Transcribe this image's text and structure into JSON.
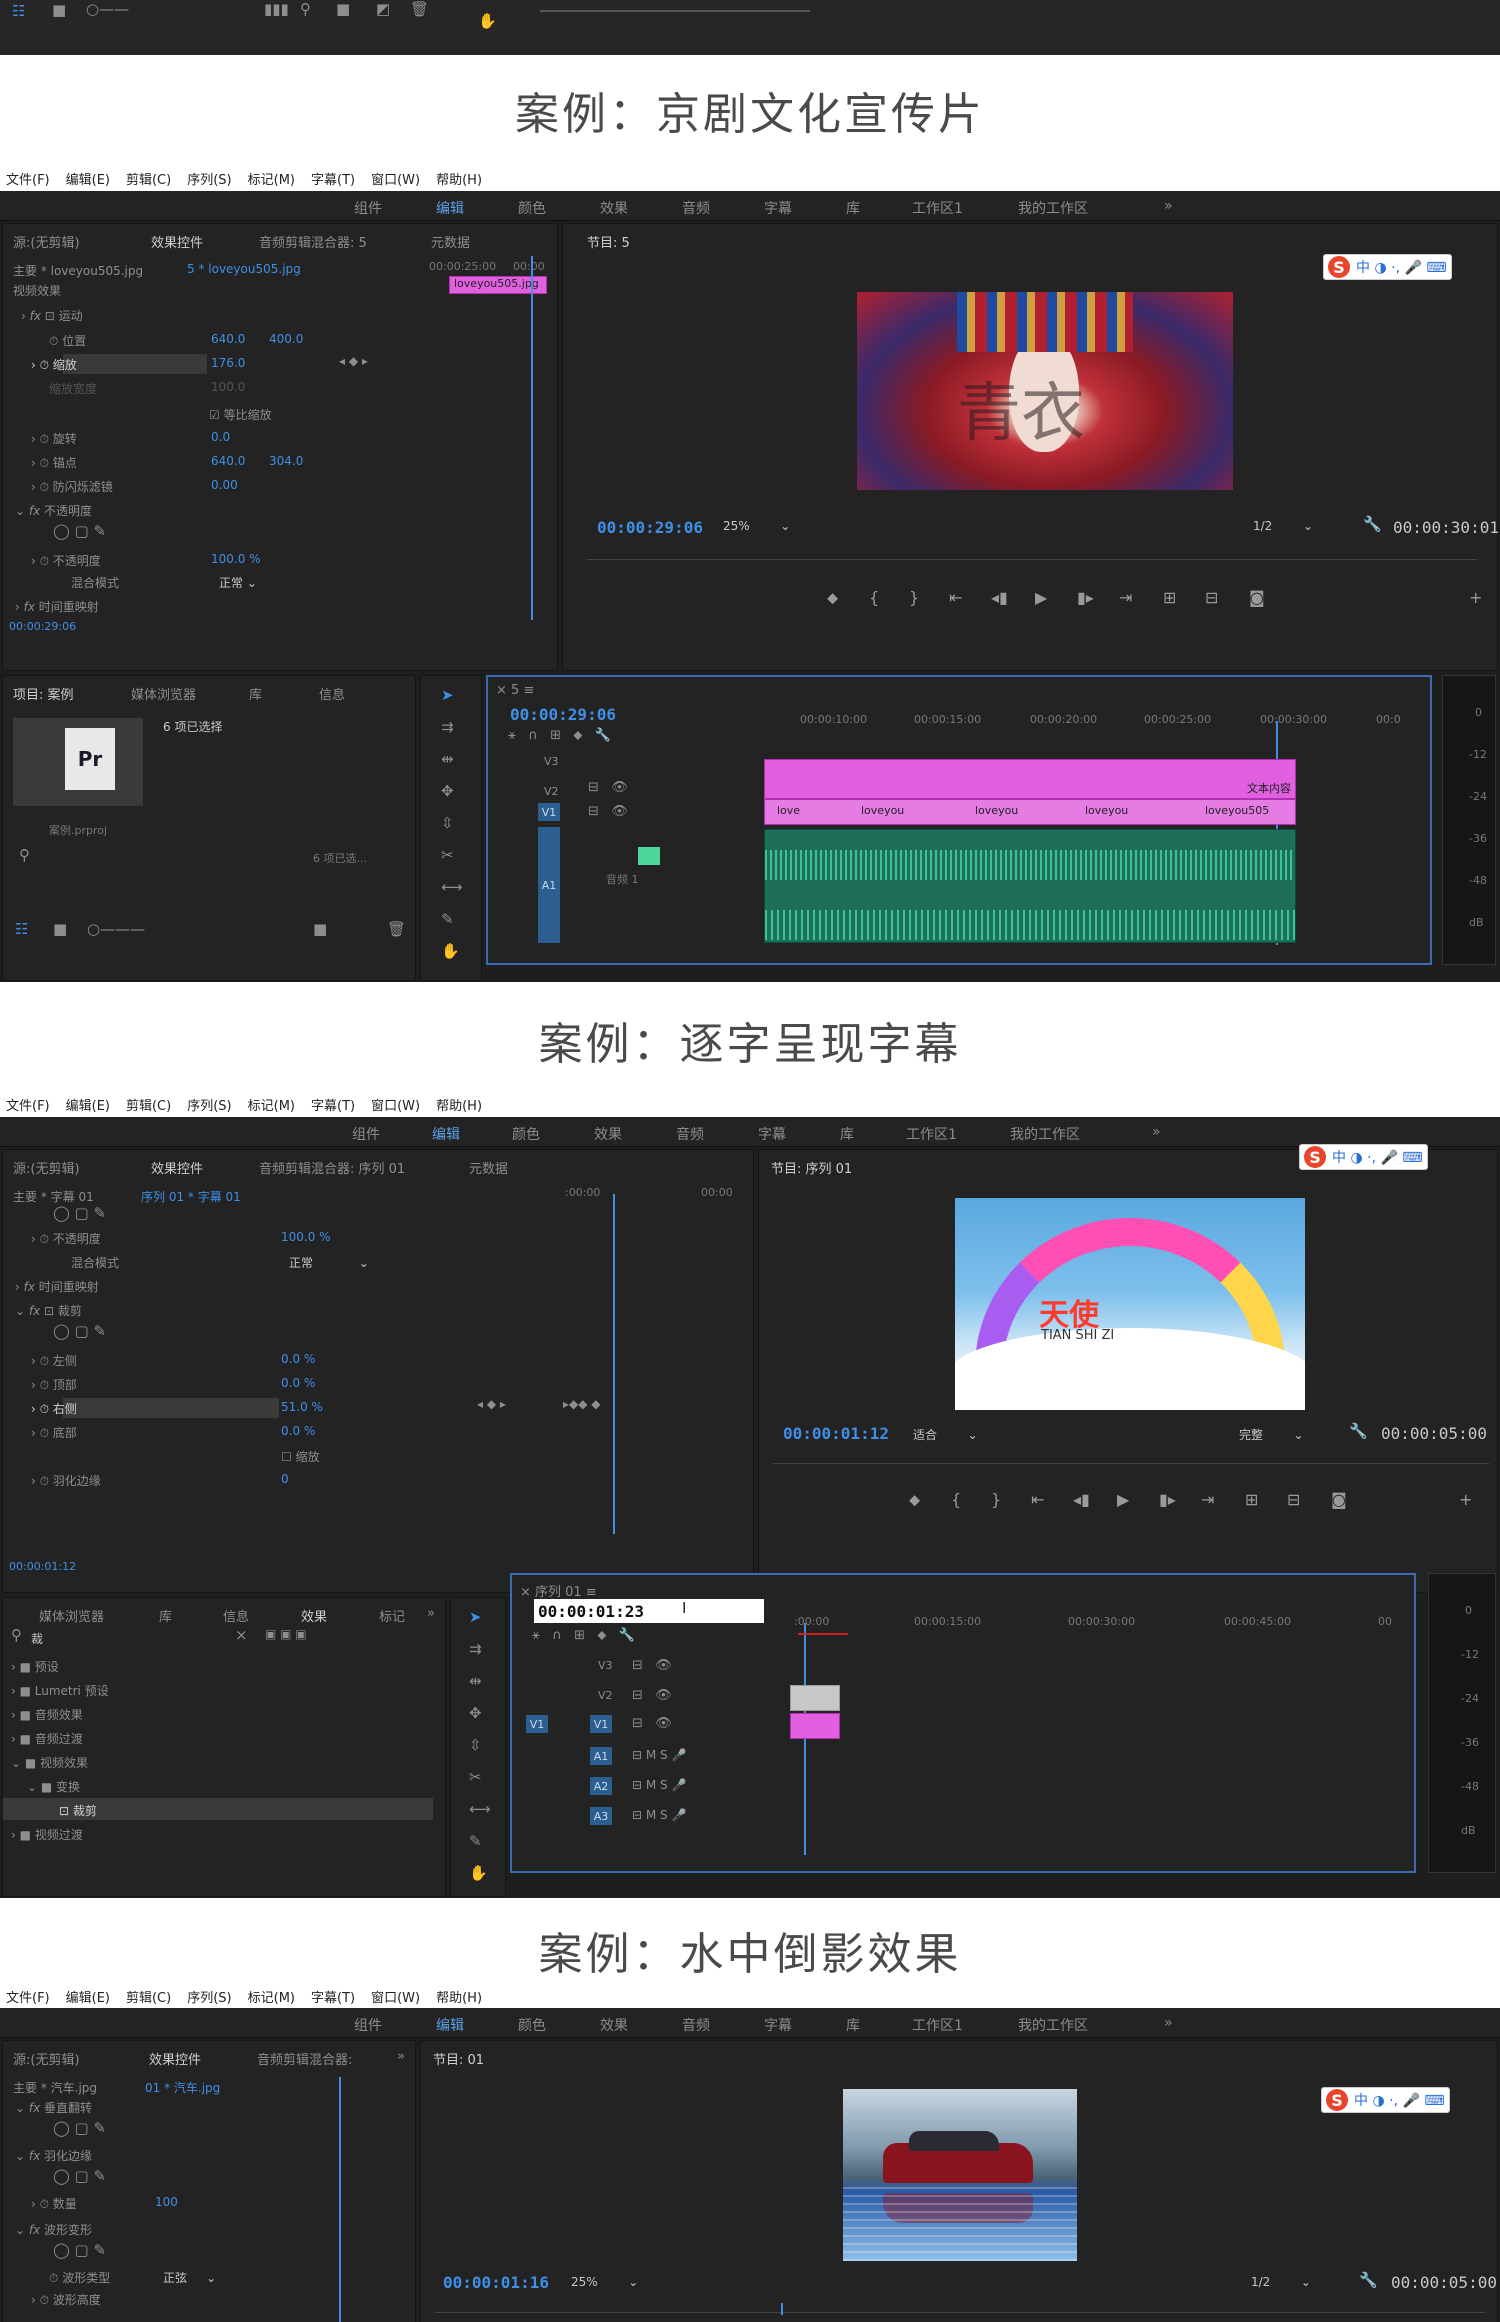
{
  "top_strip": {
    "visible": true
  },
  "captions": {
    "case1": "案例：京剧文化宣传片",
    "case2": "案例：逐字呈现字幕",
    "case3": "案例：水中倒影效果"
  },
  "menu": [
    "文件(F)",
    "编辑(E)",
    "剪辑(C)",
    "序列(S)",
    "标记(M)",
    "字幕(T)",
    "窗口(W)",
    "帮助(H)"
  ],
  "workspaces": [
    "组件",
    "编辑",
    "颜色",
    "效果",
    "音频",
    "字幕",
    "库",
    "工作区1",
    "我的工作区",
    "»"
  ],
  "ime": {
    "logo": "S",
    "text": "中 ◑ ·, 🎤 ⌨"
  },
  "s1": {
    "source_tab": "源:(无剪辑)",
    "effect_tab": "效果控件",
    "mixer_tab": "音频剪辑混合器: 5",
    "meta_tab": "元数据",
    "program_tab": "节目: 5",
    "master": "主要 * loveyou505.jpg",
    "clip": "5 * loveyou505.jpg",
    "mini_clip": "loveyou505.jpg",
    "video_fx": "视频效果",
    "fx_motion": "运动",
    "rows": [
      {
        "name": "位置",
        "v1": "640.0",
        "v2": "400.0"
      },
      {
        "name": "缩放",
        "v1": "176.0",
        "v2": ""
      },
      {
        "name": "缩放宽度",
        "v1": "100.0",
        "v2": ""
      },
      {
        "name": "等比缩放",
        "v1": "",
        "v2": ""
      },
      {
        "name": "旋转",
        "v1": "0.0",
        "v2": ""
      },
      {
        "name": "锚点",
        "v1": "640.0",
        "v2": "304.0"
      },
      {
        "name": "防闪烁滤镜",
        "v1": "0.00",
        "v2": ""
      }
    ],
    "fx_opacity": "不透明度",
    "opacity_label": "不透明度",
    "opacity_val": "100.0 %",
    "blend_label": "混合模式",
    "blend_val": "正常",
    "timeremap": "时间重映射",
    "ec_time": "00:00:29:06",
    "ec_ruler1": "00:00:25:00",
    "ec_ruler2": "00:00",
    "prog_tc": "00:00:29:06",
    "zoom": "25%",
    "res": "1/2",
    "prog_dur": "00:00:30:01",
    "project_tab": "项目: 案例",
    "media_tab": "媒体浏览器",
    "lib_tab": "库",
    "info_tab": "信息",
    "proj_items": "6 项已选择",
    "proj_file": "案例.prproj",
    "proj_sel": "6 项已选...",
    "seq_tab": "5",
    "seq_tc": "00:00:29:06",
    "tl_ruler": [
      "00:00:10:00",
      "00:00:15:00",
      "00:00:20:00",
      "00:00:25:00",
      "00:00:30:00",
      "00:0"
    ],
    "tracks": [
      "V3",
      "V2",
      "V1",
      "A1"
    ],
    "text_clip": "文本内容",
    "v1_clips": [
      "love",
      "loveyou",
      "loveyou",
      "loveyou",
      "loveyou505"
    ],
    "audio_label": "音频 1",
    "meter_scale": [
      "0",
      "-12",
      "-24",
      "-36",
      "-48",
      "dB"
    ]
  },
  "s2": {
    "source_tab": "源:(无剪辑)",
    "effect_tab": "效果控件",
    "mixer_tab": "音频剪辑混合器: 序列 01",
    "meta_tab": "元数据",
    "program_tab": "节目: 序列 01",
    "master": "主要 * 字幕 01",
    "clip": "序列 01 * 字幕 01",
    "ec_ruler1": ":00:00",
    "ec_ruler2": "00:00",
    "opacity_label": "不透明度",
    "opacity_val": "100.0 %",
    "blend_label": "混合模式",
    "blend_val": "正常",
    "timeremap": "时间重映射",
    "fx_crop": "裁剪",
    "rows": [
      {
        "name": "左侧",
        "v": "0.0 %"
      },
      {
        "name": "顶部",
        "v": "0.0 %"
      },
      {
        "name": "右侧",
        "v": "51.0 %"
      },
      {
        "name": "底部",
        "v": "0.0 %"
      },
      {
        "name": "",
        "v": "缩放"
      },
      {
        "name": "羽化边缘",
        "v": "0"
      }
    ],
    "ec_time": "00:00:01:12",
    "image_title": "天使",
    "image_sub": "TIAN SHI ZI",
    "prog_tc": "00:00:01:12",
    "fit": "适合",
    "quality": "完整",
    "prog_dur": "00:00:05:00",
    "bin_tabs": [
      "媒体浏览器",
      "库",
      "信息",
      "效果",
      "标记",
      "»"
    ],
    "search_val": "裁",
    "tree": [
      "预设",
      "Lumetri 预设",
      "音频效果",
      "音频过渡",
      "视频效果",
      "变换",
      "裁剪",
      "视频过渡"
    ],
    "seq_tab": "序列 01",
    "seq_tc": "00:00:01:23",
    "tl_ruler": [
      ":00:00",
      "00:00:15:00",
      "00:00:30:00",
      "00:00:45:00",
      "00"
    ],
    "vtracks": [
      "V3",
      "V2",
      "V1"
    ],
    "atracks": [
      "A1",
      "A2",
      "A3"
    ],
    "meter_scale": [
      "0",
      "-12",
      "-24",
      "-36",
      "-48",
      "dB"
    ]
  },
  "s3": {
    "source_tab": "源:(无剪辑)",
    "effect_tab": "效果控件",
    "mixer_tab": "音频剪辑混合器:",
    "program_tab": "节目: 01",
    "master": "主要 * 汽车.jpg",
    "clip": "01 * 汽车.jpg",
    "fx1": "垂直翻转",
    "fx2": "羽化边缘",
    "amount_label": "数量",
    "amount_val": "100",
    "fx3": "波形变形",
    "wave_label": "波形类型",
    "wave_val": "正弦",
    "wave_h": "波形高度",
    "prog_tc": "00:00:01:16",
    "zoom": "25%",
    "res": "1/2",
    "prog_dur": "00:00:05:00"
  },
  "colors": {
    "accent": "#3f8fe6",
    "pink_clip": "#e060e0",
    "audio_clip": "#1d6f5a",
    "panel": "#232323",
    "ws_active": "#5ba0e8"
  }
}
